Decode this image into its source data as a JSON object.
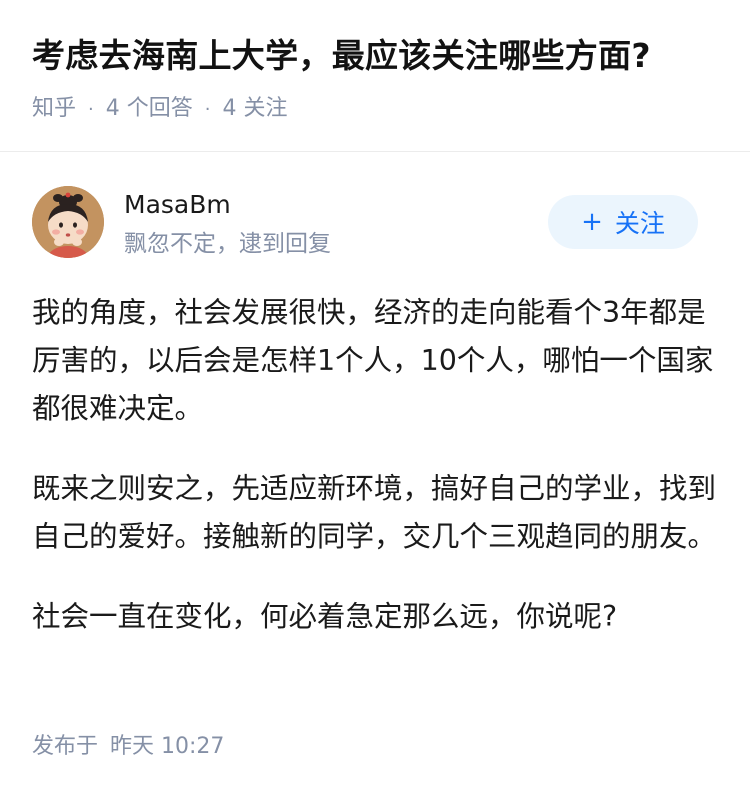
{
  "question": {
    "title": "考虑去海南上大学，最应该关注哪些方面?",
    "source": "知乎",
    "answers_count": "4 个回答",
    "followers_count": "4 关注",
    "separator": "·"
  },
  "answer": {
    "author": {
      "name": "MasaBm",
      "bio": "飘忽不定，逮到回复"
    },
    "follow_button": {
      "plus": "+",
      "label": "关注"
    },
    "paragraphs": [
      "我的角度，社会发展很快，经济的走向能看个3年都是厉害的，以后会是怎样1个人，10个人，哪怕一个国家都很难决定。",
      "既来之则安之，先适应新环境，搞好自己的学业，找到自己的爱好。接触新的同学，交几个三观趋同的朋友。",
      "社会一直在变化，何必着急定那么远，你说呢?"
    ],
    "publish": {
      "label": "发布于",
      "time": "昨天 10:27"
    }
  },
  "colors": {
    "accent": "#1772f6",
    "follow_bg": "#ebf5fd",
    "meta_gray": "#8590a6"
  }
}
